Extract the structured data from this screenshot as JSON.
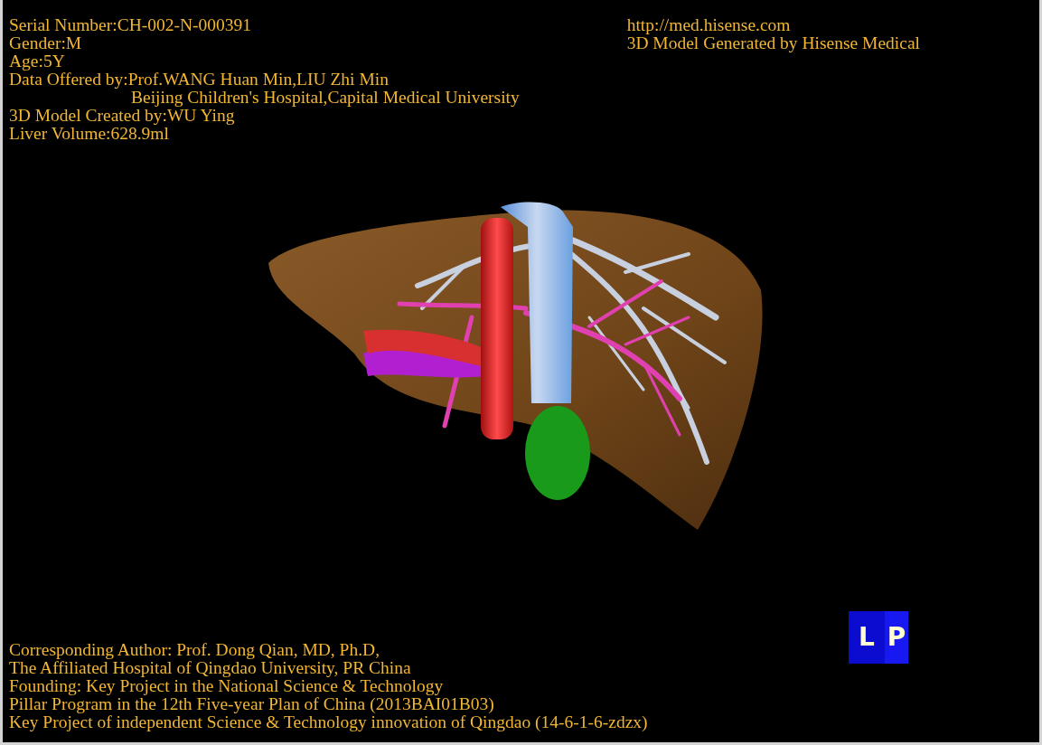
{
  "patient_info": [
    {
      "text": "Serial Number:CH-002-N-000391"
    },
    {
      "text": "Gender:M"
    },
    {
      "text": "Age:5Y"
    },
    {
      "text": "Data Offered by:Prof.WANG Huan Min,LIU Zhi Min",
      "continuation": "Beijing Children's Hospital,Capital Medical University"
    },
    {
      "text": "3D Model Created by:WU Ying"
    },
    {
      "text": "Liver Volume:628.9ml"
    }
  ],
  "branding": [
    {
      "text": "http://med.hisense.com"
    },
    {
      "text": "3D Model Generated by Hisense Medical"
    }
  ],
  "credits": [
    {
      "text": "Corresponding Author: Prof. Dong Qian, MD, Ph.D,"
    },
    {
      "text": "The Affiliated Hospital of Qingdao University, PR China"
    },
    {
      "text": "Founding: Key Project in the National Science & Technology"
    },
    {
      "text": "Pillar Program in the 12th Five-year Plan of China (2013BAI01B03)"
    },
    {
      "text": "Key Project of independent Science & Technology innovation of Qingdao (14-6-1-6-zdzx)"
    }
  ],
  "orientation_cube": {
    "front": "L",
    "side": "P"
  }
}
